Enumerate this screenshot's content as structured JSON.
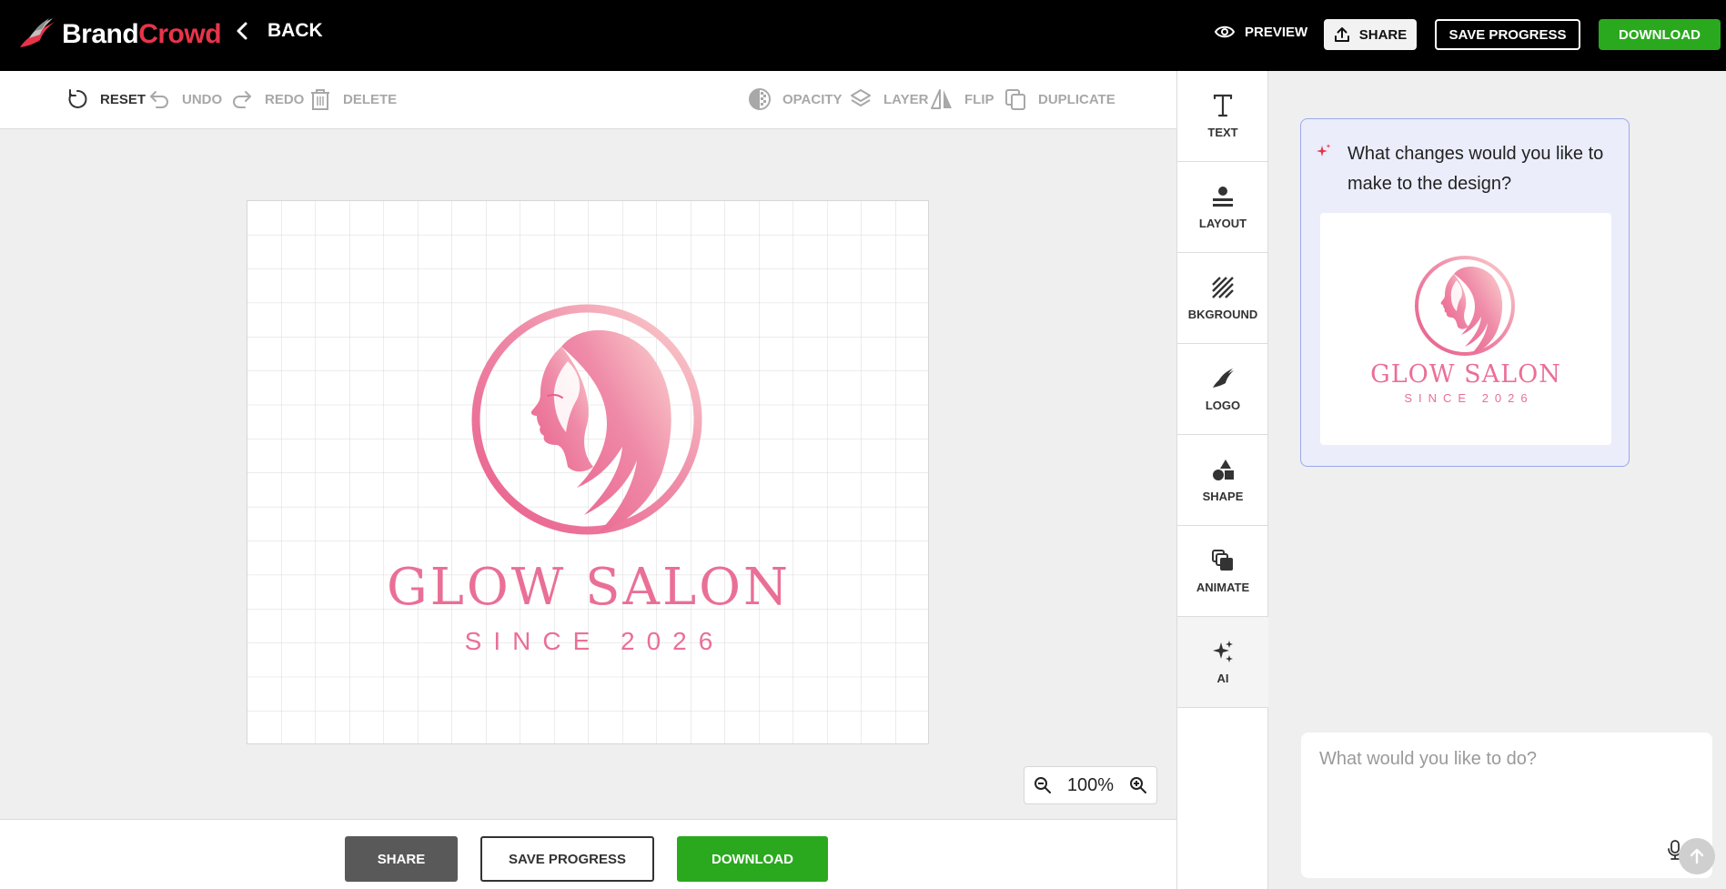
{
  "brand": {
    "name_part1": "Brand",
    "name_part2": "Crowd"
  },
  "nav": {
    "back_label": "BACK"
  },
  "header": {
    "preview_label": "PREVIEW",
    "share_label": "SHARE",
    "save_label": "SAVE PROGRESS",
    "download_label": "DOWNLOAD"
  },
  "toolbar": {
    "reset": "RESET",
    "undo": "UNDO",
    "redo": "REDO",
    "delete": "DELETE",
    "opacity": "OPACITY",
    "layer": "LAYER",
    "flip": "FLIP",
    "duplicate": "DUPLICATE"
  },
  "design": {
    "title": "GLOW SALON",
    "subtitle": "SINCE 2026"
  },
  "zoom": {
    "value": "100%"
  },
  "footer": {
    "share_label": "SHARE",
    "save_label": "SAVE PROGRESS",
    "download_label": "DOWNLOAD"
  },
  "rail": {
    "items": [
      {
        "label": "TEXT",
        "icon": "text-icon"
      },
      {
        "label": "LAYOUT",
        "icon": "layout-icon"
      },
      {
        "label": "BKGROUND",
        "icon": "background-icon"
      },
      {
        "label": "LOGO",
        "icon": "logo-icon"
      },
      {
        "label": "SHAPE",
        "icon": "shape-icon"
      },
      {
        "label": "ANIMATE",
        "icon": "animate-icon"
      },
      {
        "label": "AI",
        "icon": "ai-sparkle-icon"
      }
    ]
  },
  "ai": {
    "question": "What changes would you like to make to the design?",
    "preview_title": "GLOW SALON",
    "preview_subtitle": "SINCE 2026",
    "input_placeholder": "What would you like to do?"
  },
  "colors": {
    "brand_red": "#e8344a",
    "accent_green": "#2aa91e",
    "logo_pink": "#ea6f96",
    "ai_card_bg": "#ebedfb",
    "ai_card_border": "#9aa9e8"
  }
}
